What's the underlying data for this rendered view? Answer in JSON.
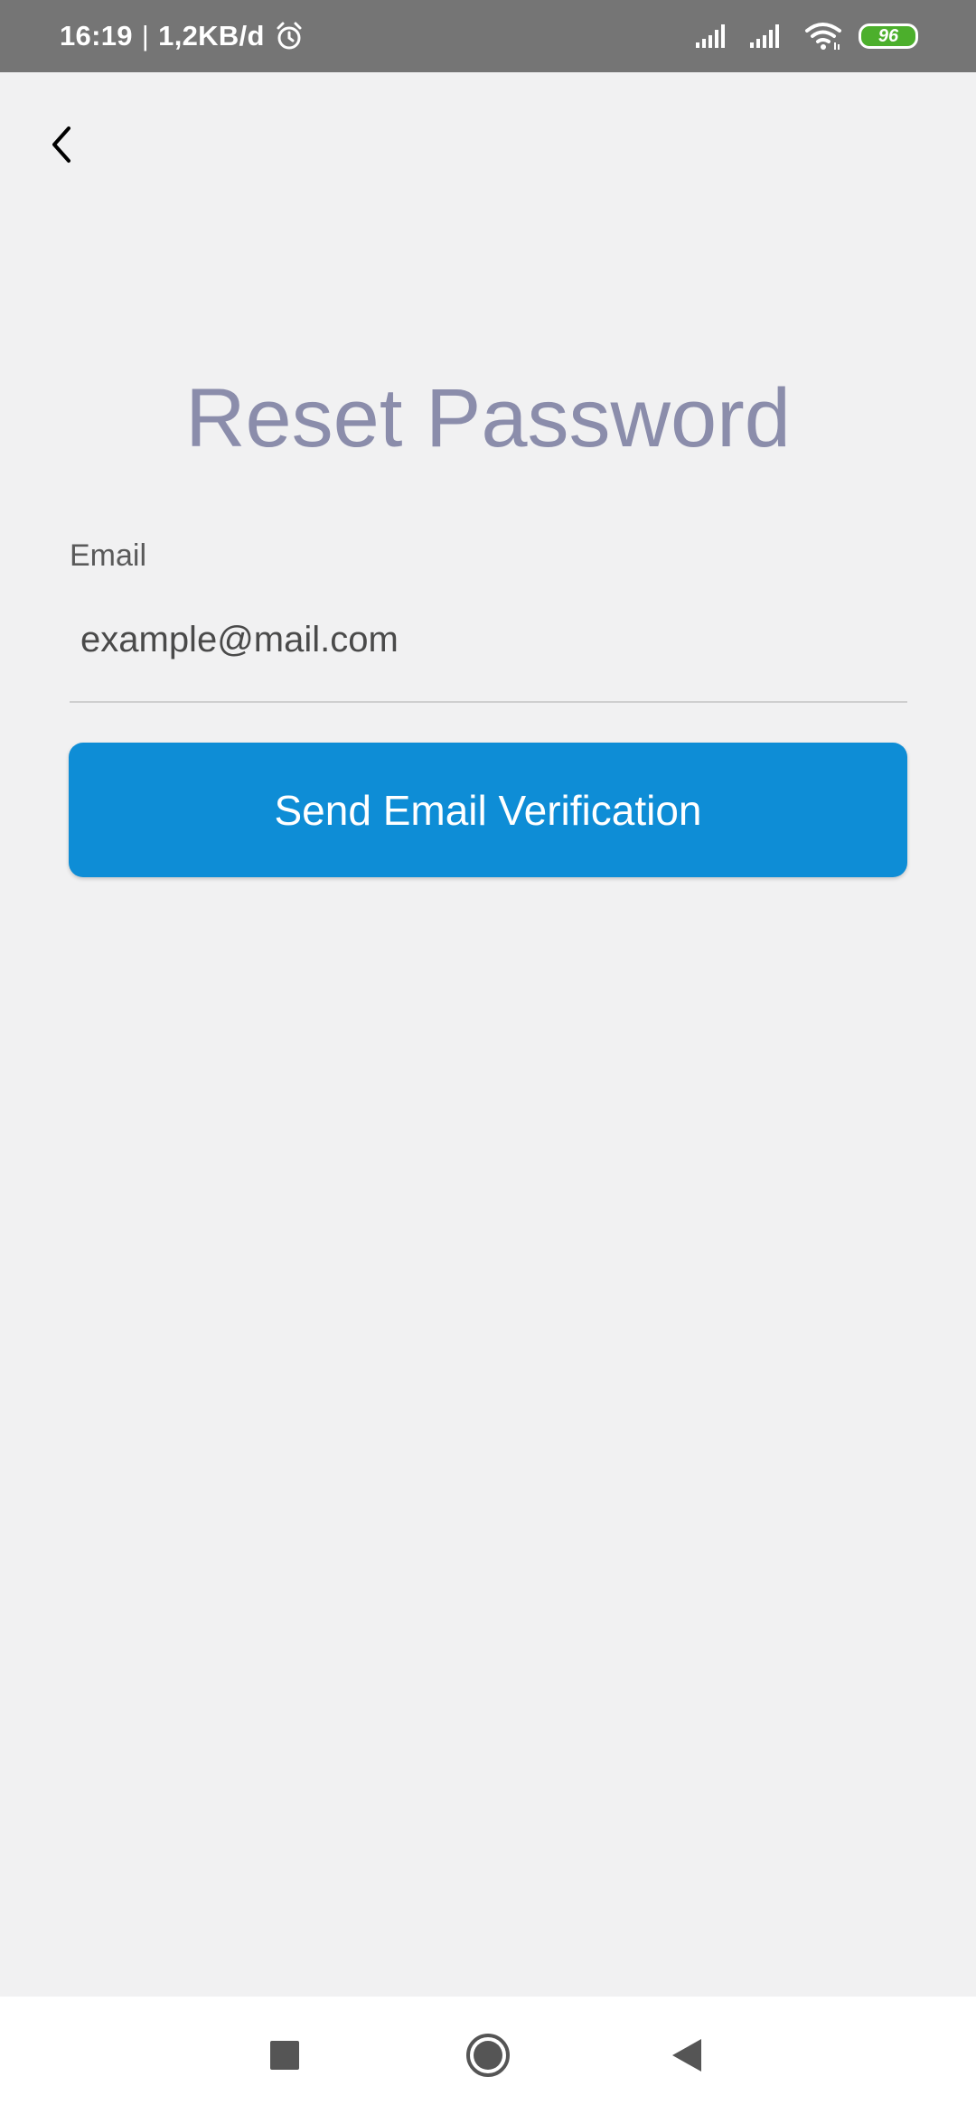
{
  "status_bar": {
    "time": "16:19",
    "separator": "|",
    "data_rate": "1,2KB/d",
    "battery_level": "96",
    "battery_color": "#4caf2c",
    "icons": [
      "alarm-icon",
      "signal-icon",
      "signal-icon",
      "wifi-icon",
      "battery-icon"
    ]
  },
  "header": {
    "back_icon": "chevron-left-icon"
  },
  "page": {
    "title": "Reset Password"
  },
  "form": {
    "email_label": "Email",
    "email_placeholder": "example@mail.com",
    "email_value": "",
    "submit_label": "Send Email Verification"
  },
  "nav_bar": {
    "icons": [
      "recent-apps-icon",
      "home-icon",
      "back-icon"
    ]
  },
  "colors": {
    "accent": "#0e8dd6",
    "title": "#8b8dab",
    "background": "#f1f1f2",
    "status_bar": "#757575"
  }
}
